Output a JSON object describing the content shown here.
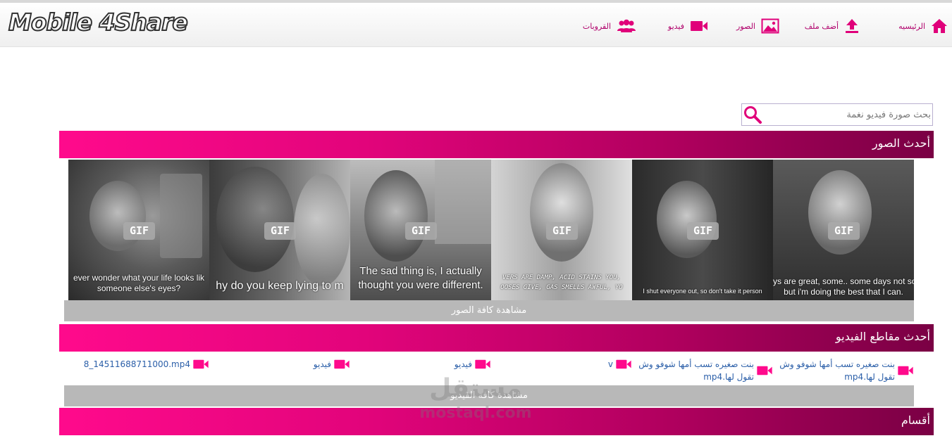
{
  "header": {
    "logo": "Mobile 4Share",
    "nav": [
      {
        "label": "الرئيسيه",
        "icon": "home-icon"
      },
      {
        "label": "أضف ملف",
        "icon": "upload-icon"
      },
      {
        "label": "الصور",
        "icon": "image-icon"
      },
      {
        "label": "فيديو",
        "icon": "video-camera-icon"
      },
      {
        "label": "القروبات",
        "icon": "group-icon"
      }
    ]
  },
  "search": {
    "placeholder": "بحث صورة فيديو نغمة"
  },
  "latest_images": {
    "title": "أحدث الصور",
    "view_all": "مشاهدة كافة الصور",
    "badge": "GIF",
    "items": [
      {
        "caption_line1": "ever wonder what your life looks lik",
        "caption_line2": "someone else's eyes?"
      },
      {
        "caption_line1": "hy do you keep lying to m",
        "caption_line2": ""
      },
      {
        "caption_line1": "The sad thing is, I actually",
        "caption_line2": "thought you were different."
      },
      {
        "caption_line1": "VERS ARE DAMP, ACID STAINS YOU,",
        "caption_line2": "OOSES GIVE, GAS SMELLS AWFUL, YO"
      },
      {
        "caption_line1": "I shut everyone out, so don't take it person",
        "caption_line2": ""
      },
      {
        "caption_line1": "ys are great, some.. some days not so",
        "caption_line2": "but i'm doing the best that I can."
      }
    ]
  },
  "latest_videos": {
    "title": "أحدث مقاطع الفيديو",
    "view_all": "مشاهدة كافة الفيديو",
    "items": [
      {
        "title": "بنت صغيره تسب أمها شوفو وش تقول لها.mp4"
      },
      {
        "title": "بنت صغيره تسب أمها شوفو وش تقول لها.mp4"
      },
      {
        "title": "v"
      },
      {
        "title": "فيديو"
      },
      {
        "title": "فيديو"
      },
      {
        "title": "8_14511688711000.mp4"
      }
    ]
  },
  "categories": {
    "title": "أقسام"
  },
  "watermark": {
    "arabic": "مستقل",
    "latin": "mostaql.com"
  },
  "colors": {
    "accent": "#ff0a8c",
    "accent_dark": "#7a0044",
    "link": "#2a5ea8",
    "button_gray": "#b8b8b8"
  }
}
